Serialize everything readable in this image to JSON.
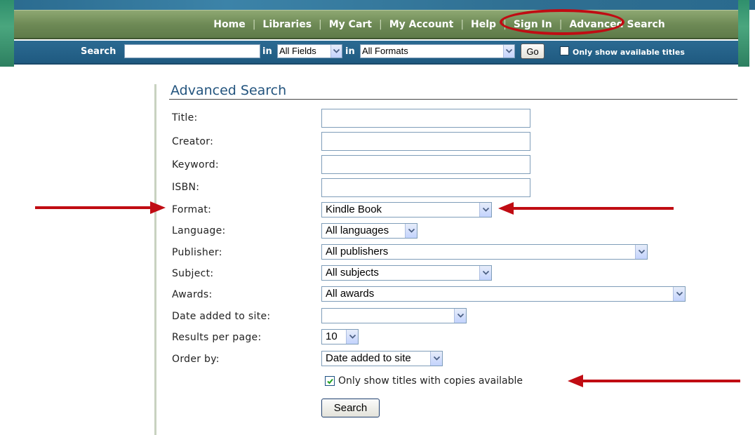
{
  "nav": {
    "links": [
      "Home",
      "Libraries",
      "My Cart",
      "My Account",
      "Help",
      "Sign In",
      "Advanced Search"
    ],
    "separator": "|"
  },
  "quick_search": {
    "label": "Search",
    "in1": "in",
    "field_value": "All Fields",
    "in2": "in",
    "format_value": "All Formats",
    "go_label": "Go",
    "available_label": "Only show available titles"
  },
  "advanced": {
    "title": "Advanced Search",
    "title_label": "Title:",
    "creator_label": "Creator:",
    "keyword_label": "Keyword:",
    "isbn_label": "ISBN:",
    "format_label": "Format:",
    "format_value": "Kindle Book",
    "language_label": "Language:",
    "language_value": "All languages",
    "publisher_label": "Publisher:",
    "publisher_value": "All publishers",
    "subject_label": "Subject:",
    "subject_value": "All subjects",
    "awards_label": "Awards:",
    "awards_value": "All awards",
    "date_added_label": "Date added to site:",
    "date_added_value": "",
    "results_label": "Results per page:",
    "results_value": "10",
    "order_label": "Order by:",
    "order_value": "Date added to site",
    "copies_available_label": "Only show titles with copies available",
    "copies_available_checked": true,
    "search_button": "Search"
  },
  "colors": {
    "annotation_red": "#c00c13",
    "nav_green": "#6e8a56",
    "search_blue": "#1f5a80",
    "title_blue": "#23547e"
  }
}
